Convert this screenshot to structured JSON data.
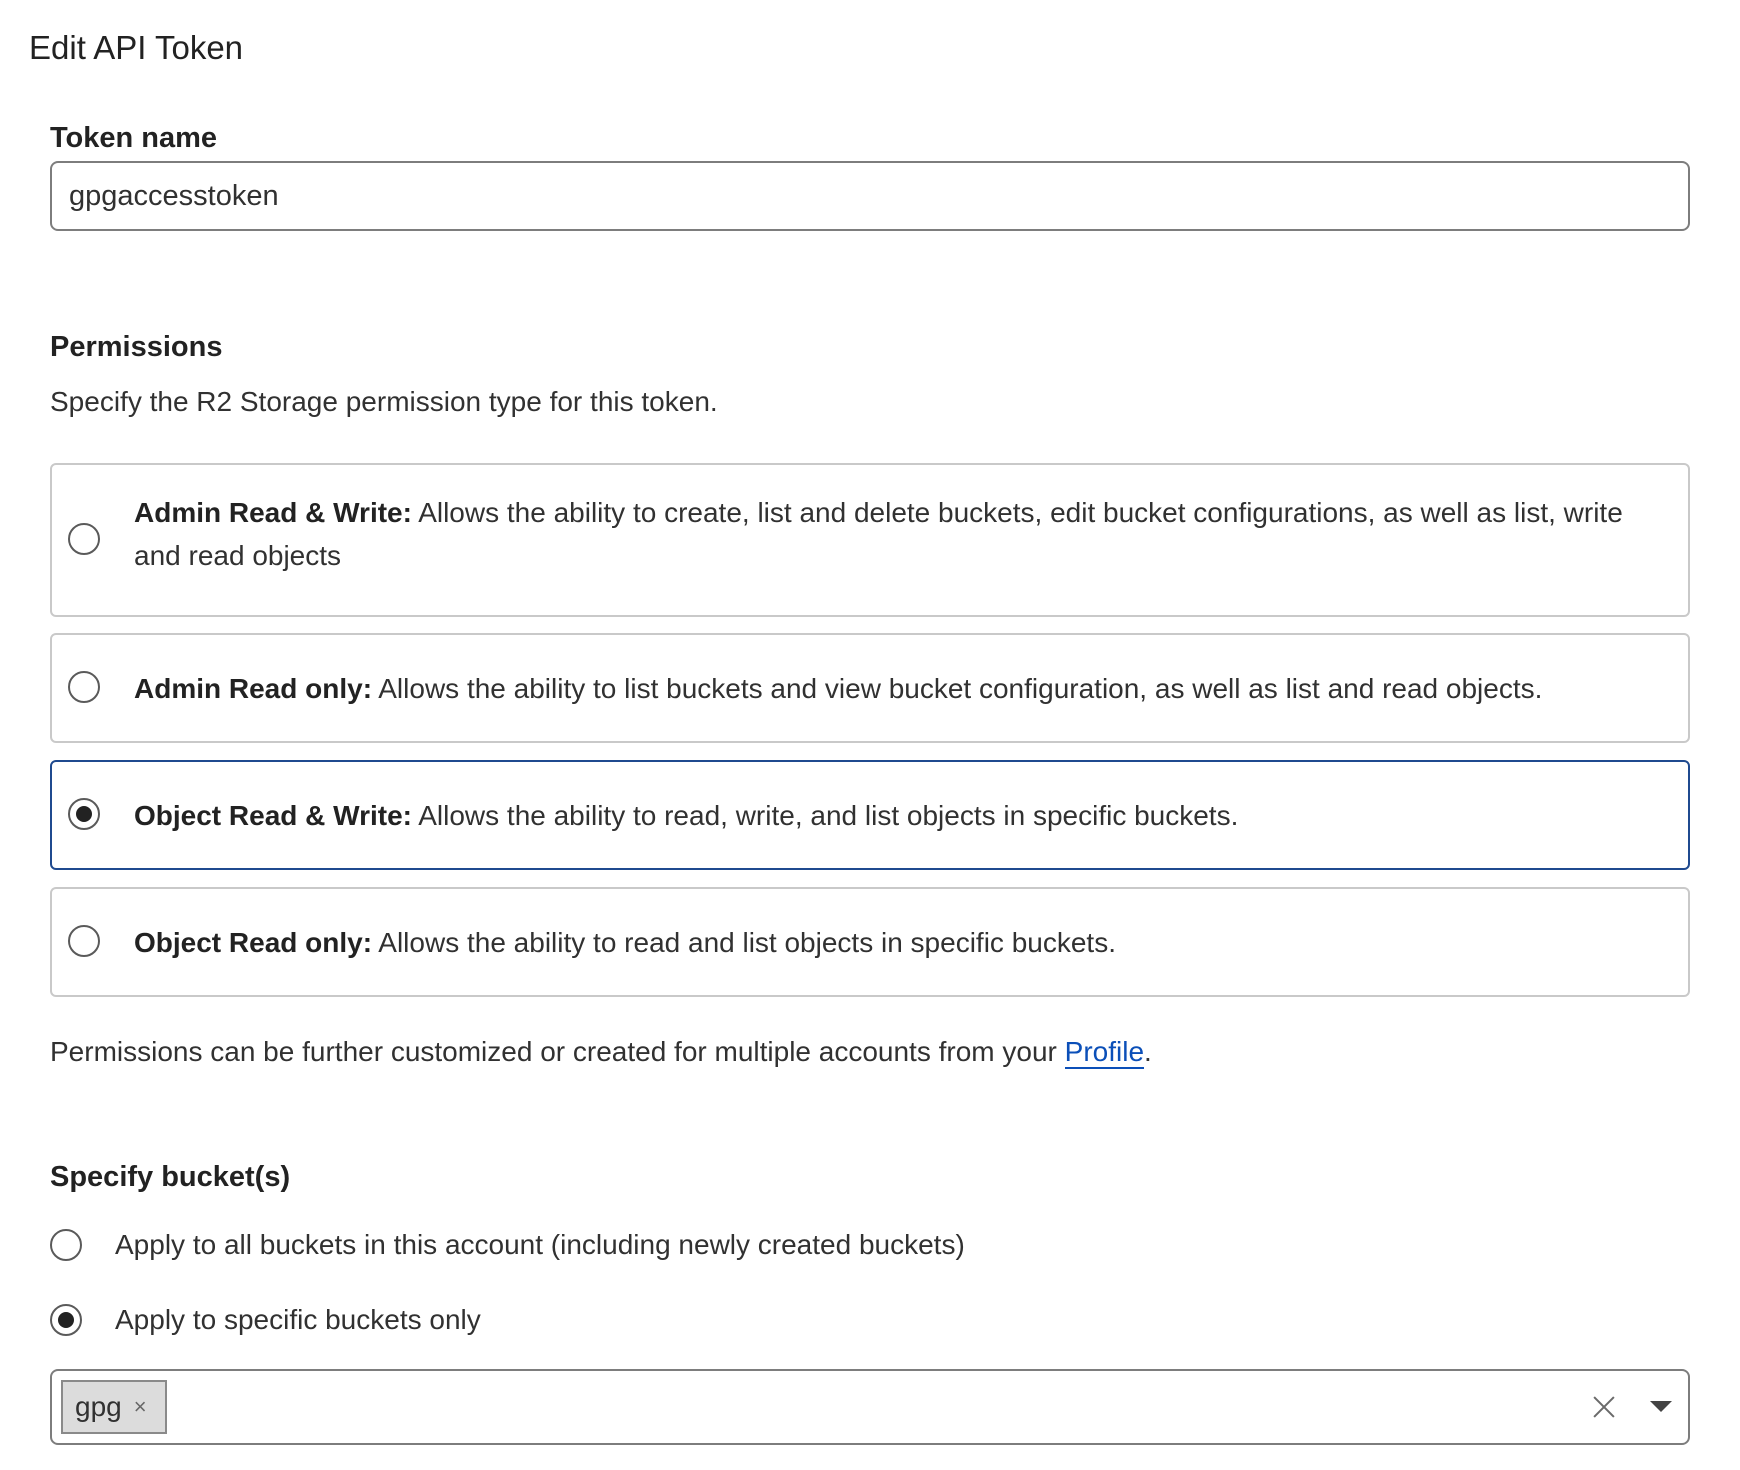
{
  "page": {
    "title": "Edit API Token"
  },
  "token_name": {
    "label": "Token name",
    "value": "gpgaccesstoken"
  },
  "permissions": {
    "heading": "Permissions",
    "description": "Specify the R2 Storage permission type for this token.",
    "selected": "object_read_write",
    "options": [
      {
        "id": "admin_read_write",
        "title": "Admin Read & Write:",
        "description": " Allows the ability to create, list and delete buckets, edit bucket configurations, as well as list, write and read objects"
      },
      {
        "id": "admin_read_only",
        "title": "Admin Read only:",
        "description": " Allows the ability to list buckets and view bucket configuration, as well as list and read objects."
      },
      {
        "id": "object_read_write",
        "title": "Object Read & Write:",
        "description": " Allows the ability to read, write, and list objects in specific buckets."
      },
      {
        "id": "object_read_only",
        "title": "Object Read only:",
        "description": " Allows the ability to read and list objects in specific buckets."
      }
    ],
    "note_prefix": "Permissions can be further customized or created for multiple accounts from your ",
    "note_link": "Profile",
    "note_suffix": "."
  },
  "buckets": {
    "heading": "Specify bucket(s)",
    "selected": "specific",
    "options": [
      {
        "id": "all",
        "label": "Apply to all buckets in this account (including newly created buckets)"
      },
      {
        "id": "specific",
        "label": "Apply to specific buckets only"
      }
    ],
    "selected_buckets": [
      "gpg"
    ],
    "chip_remove_symbol": "×"
  },
  "icons": {
    "chip_remove": "close-icon",
    "clear": "clear-icon",
    "dropdown": "chevron-down-icon"
  }
}
